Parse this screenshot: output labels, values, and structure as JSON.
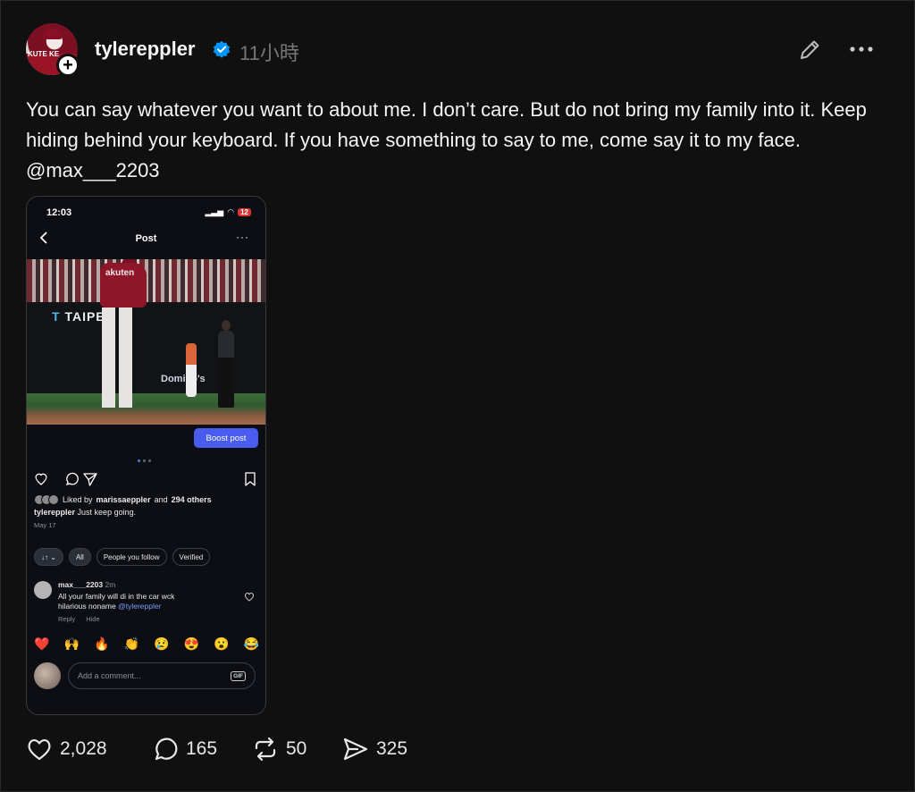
{
  "header": {
    "username": "tylereppler",
    "timestamp": "11小時",
    "avatar_text": "KUTE KE"
  },
  "post": {
    "text": "You can say whatever you want to about me. I don’t care. But do not bring my family into it. Keep hiding behind your keyboard. If you have something to say to me, come say it to my face. @max___2203"
  },
  "embedded": {
    "status_time": "12:03",
    "battery": "12",
    "title": "Post",
    "banner_text": "TAIPE",
    "banner_sub": "Domino's",
    "jersey_text": "akuten",
    "boost_label": "Boost post",
    "liked_prefix": "Liked by",
    "liked_user": "marissaeppler",
    "liked_mid": "and",
    "liked_others": "294 others",
    "caption_user": "tylereppler",
    "caption_text": "Just keep going.",
    "date": "May 17",
    "chips": [
      "All",
      "People you follow",
      "Verified"
    ],
    "comment": {
      "user": "max___2203",
      "time": "2m",
      "line1": "All your family will di in the car wck",
      "line2": "hilarious noname",
      "mention": "@tylereppler",
      "reply": "Reply",
      "hide": "Hide"
    },
    "emojis": [
      "❤️",
      "🙌",
      "🔥",
      "👏",
      "😢",
      "😍",
      "😮",
      "😂"
    ],
    "comment_placeholder": "Add a comment...",
    "gif_label": "GIF"
  },
  "stats": {
    "likes": "2,028",
    "comments": "165",
    "reposts": "50",
    "shares": "325"
  },
  "colors": {
    "background": "#101010",
    "verified": "#0095f6",
    "boost": "#4a5cf0",
    "mention": "#7b9cf3"
  }
}
